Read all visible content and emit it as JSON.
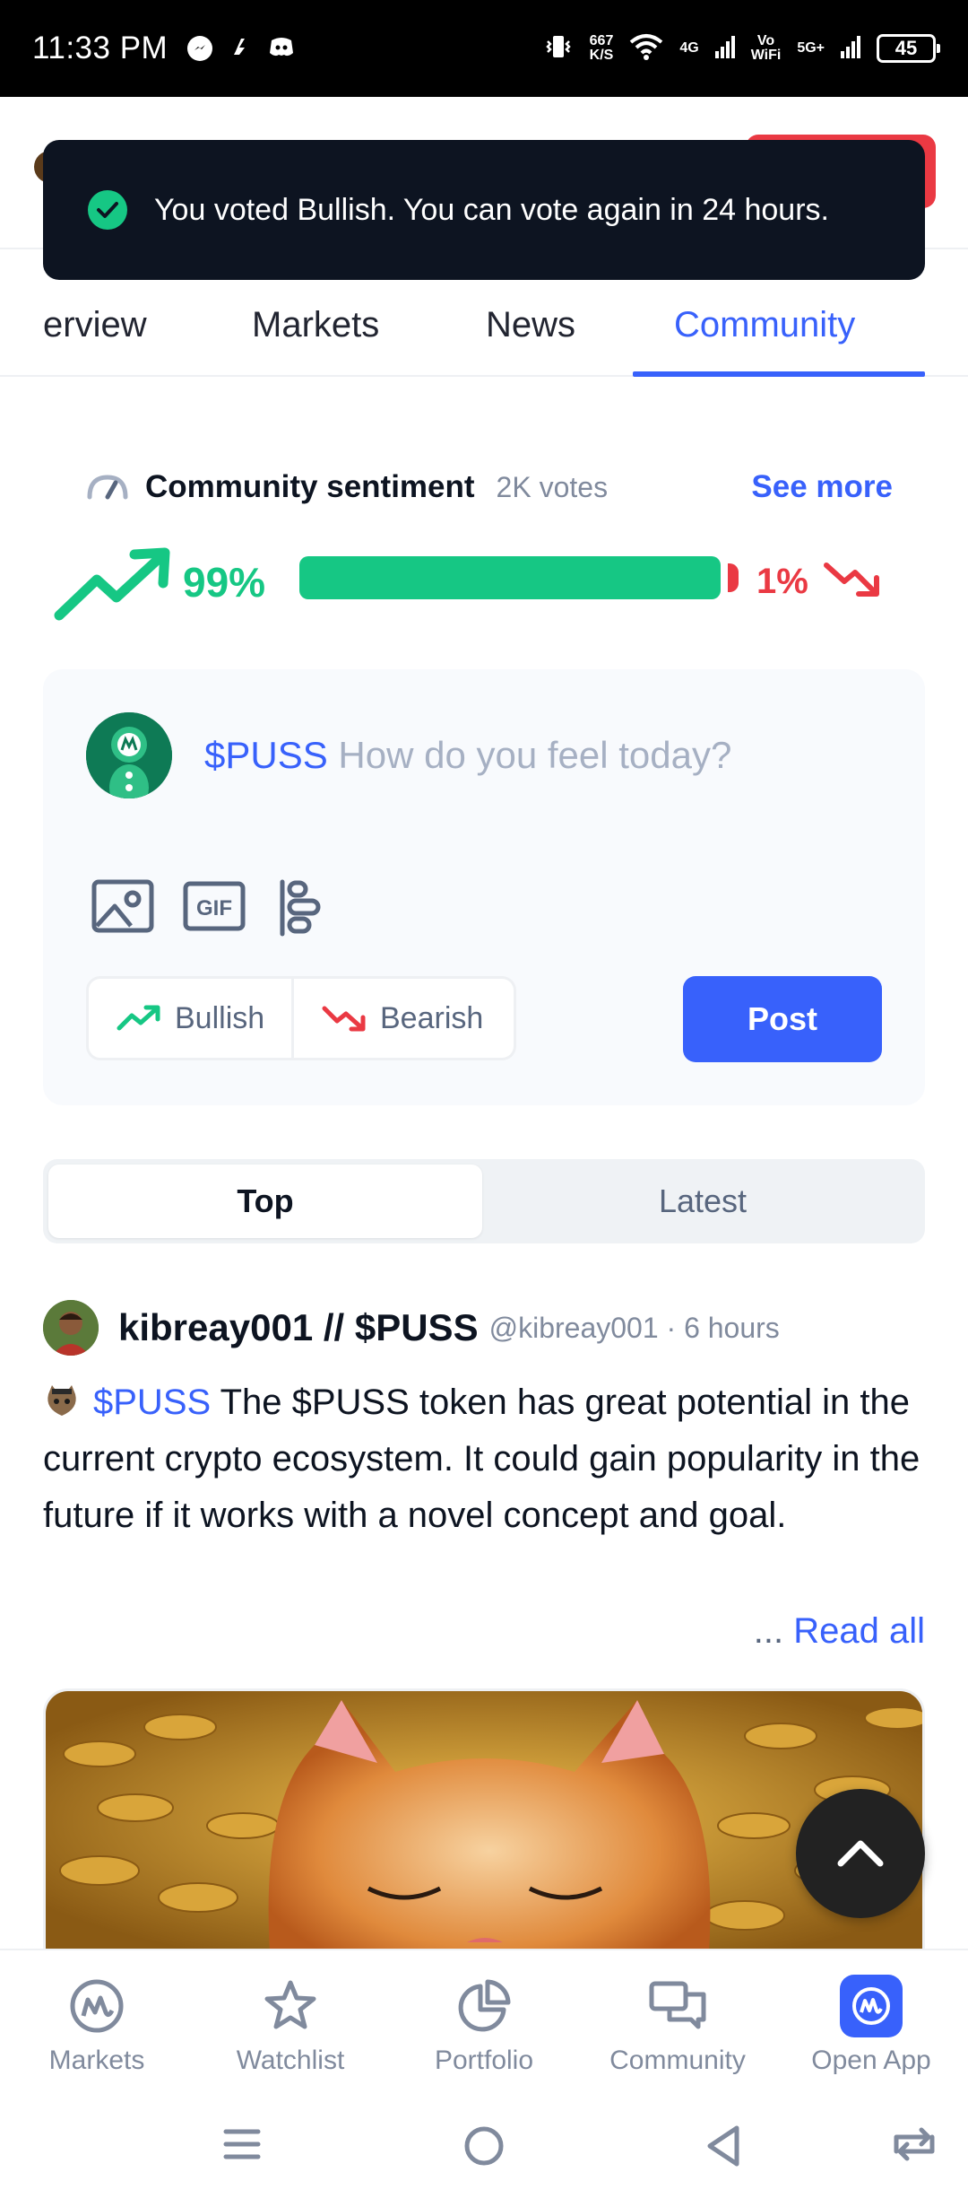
{
  "status_bar": {
    "time": "11:33 PM",
    "net_speed_top": "667",
    "net_speed_bottom": "K/S",
    "net1": "4G",
    "net2_top": "Vo",
    "net2_bottom": "WiFi",
    "net3": "5G+",
    "battery": "45"
  },
  "toast": {
    "message": "You voted Bullish. You can vote again in 24 hours."
  },
  "tabs": [
    {
      "label": "erview",
      "active": false
    },
    {
      "label": "Markets",
      "active": false
    },
    {
      "label": "News",
      "active": false
    },
    {
      "label": "Community",
      "active": true
    }
  ],
  "sentiment": {
    "title": "Community sentiment",
    "votes": "2K votes",
    "see_more": "See more",
    "bullish_pct": "99%",
    "bearish_pct": "1%",
    "bullish_fraction": 0.99
  },
  "composer": {
    "tag": "$PUSS",
    "placeholder": "How do you feel today?",
    "gif_label": "GIF",
    "bullish_label": "Bullish",
    "bearish_label": "Bearish",
    "post_label": "Post"
  },
  "feed_toggle": {
    "top_label": "Top",
    "latest_label": "Latest",
    "selected": "Top"
  },
  "post": {
    "author": "kibreay001 // $PUSS",
    "handle": "@kibreay001 · 6 hours",
    "tag": "$PUSS",
    "text": "The $PUSS token has great potential in the current crypto ecosystem. It could gain popularity in the future if it works with a novel concept and goal.",
    "read_more_dots": "...",
    "read_more_link": "Read all"
  },
  "bottom_nav": [
    {
      "label": "Markets",
      "icon": "markets-icon"
    },
    {
      "label": "Watchlist",
      "icon": "star-icon"
    },
    {
      "label": "Portfolio",
      "icon": "pie-chart-icon"
    },
    {
      "label": "Community",
      "icon": "chat-icon"
    },
    {
      "label": "Open App",
      "icon": "app-logo-icon"
    }
  ],
  "colors": {
    "accent": "#3861fb",
    "bullish": "#16c784",
    "bearish": "#ea3943",
    "toast_bg": "#0d1421"
  }
}
